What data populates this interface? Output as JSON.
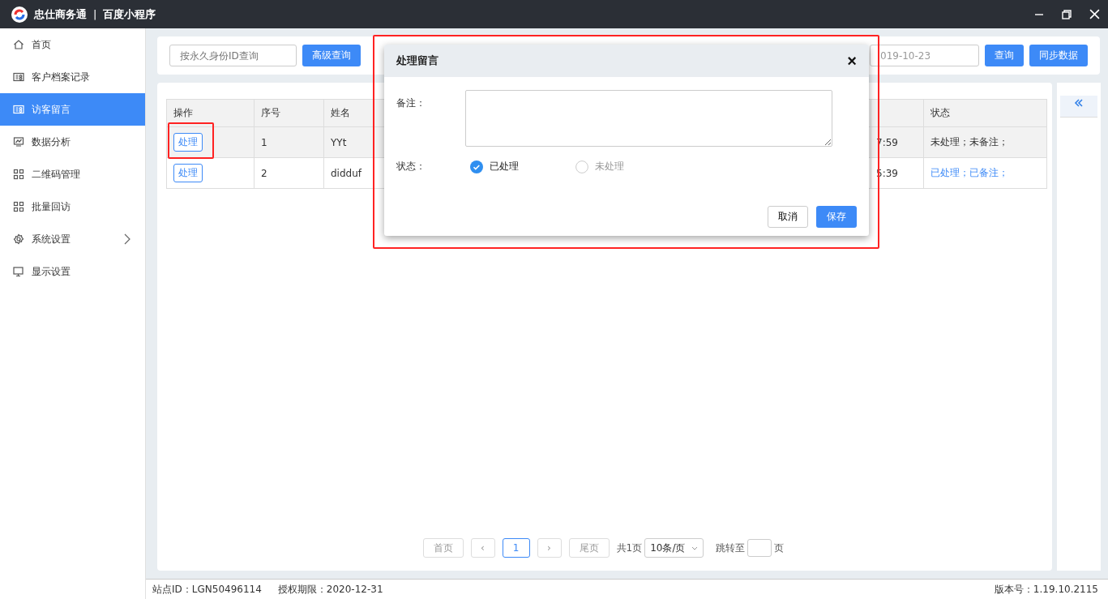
{
  "window": {
    "app_name": "忠仕商务通",
    "separator": "|",
    "section": "百度小程序"
  },
  "sidebar": {
    "items": [
      {
        "label": "首页",
        "selected": false,
        "has_submenu": false
      },
      {
        "label": "客户档案记录",
        "selected": false,
        "has_submenu": false
      },
      {
        "label": "访客留言",
        "selected": true,
        "has_submenu": false
      },
      {
        "label": "数据分析",
        "selected": false,
        "has_submenu": false
      },
      {
        "label": "二维码管理",
        "selected": false,
        "has_submenu": false
      },
      {
        "label": "批量回访",
        "selected": false,
        "has_submenu": false
      },
      {
        "label": "系统设置",
        "selected": false,
        "has_submenu": true
      },
      {
        "label": "显示设置",
        "selected": false,
        "has_submenu": false
      }
    ]
  },
  "toolbar": {
    "search": {
      "placeholder": "按永久身份ID查询"
    },
    "advanced_button": "高级查询",
    "date_field": {
      "value": "019-10-23"
    },
    "query_button": "查询",
    "sync_button": "同步数据"
  },
  "table": {
    "columns": [
      "操作",
      "序号",
      "姓名",
      "",
      "",
      "状态"
    ],
    "rows": [
      {
        "action": "处理",
        "index": "1",
        "name": "YYt",
        "column_5": "7:59",
        "status": "未处理；未备注；",
        "processed": false,
        "selected": true
      },
      {
        "action": "处理",
        "index": "2",
        "name": "didduf",
        "column_5": "5:39",
        "status": "已处理；已备注；",
        "processed": true,
        "selected": false
      }
    ]
  },
  "pagination": {
    "first": "首页",
    "prev": "‹",
    "page": "1",
    "next": "›",
    "last": "尾页",
    "total": "共1页",
    "page_size": "10条/页",
    "jump_label": "跳转至",
    "jump_suffix": "页"
  },
  "dialog": {
    "title": "处理留言",
    "close": "×",
    "remark_label": "备注：",
    "status_label": "状态：",
    "options": [
      {
        "label": "已处理",
        "selected": true
      },
      {
        "label": "未处理",
        "selected": false
      }
    ],
    "cancel": "取消",
    "save": "保存"
  },
  "status_bar": {
    "site_id": "站点ID：LGN50496114",
    "license": "授权期限：2020-12-31",
    "version": "版本号：1.19.10.2115"
  }
}
